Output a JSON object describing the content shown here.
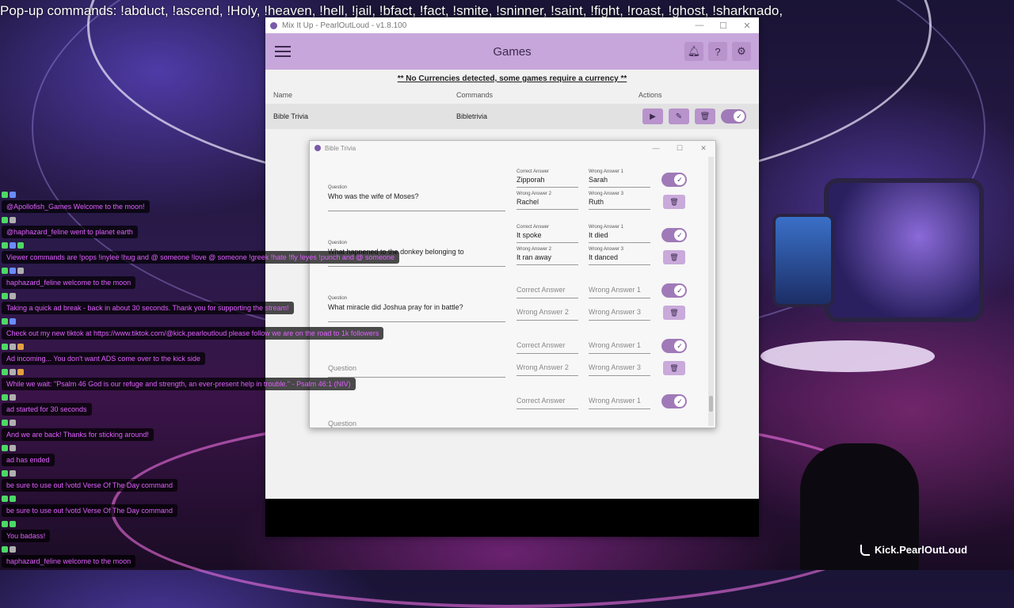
{
  "ticker": "Pop-up commands: !abduct, !ascend, !Holy, !heaven, !hell,  !jail, !bfact, !fact, !smite, !sninner, !saint, !fight, !roast, !ghost, !sharknado,",
  "app": {
    "title": "Mix It Up - PearlOutLoud - v1.8.100",
    "header_title": "Games",
    "notice": "** No Currencies detected, some games require a currency **",
    "columns": {
      "name": "Name",
      "commands": "Commands",
      "actions": "Actions"
    },
    "games": [
      {
        "name": "Bible Trivia",
        "command": "Bibletrivia",
        "enabled": true
      }
    ],
    "icons": [
      "menu-icon",
      "bell-icon",
      "help-icon",
      "gear-icon"
    ],
    "accent": "#c7a6db"
  },
  "dialog": {
    "title": "Bible Trivia",
    "labels": {
      "question": "Question",
      "correct": "Correct Answer",
      "wrong1": "Wrong Answer 1",
      "wrong2": "Wrong Answer 2",
      "wrong3": "Wrong Answer 3"
    },
    "questions": [
      {
        "question": "Who was the wife of Moses?",
        "correct": "Zipporah",
        "wrong1": "Sarah",
        "wrong2": "Rachel",
        "wrong3": "Ruth",
        "enabled": true
      },
      {
        "question": "What happened to the donkey belonging to",
        "correct": "It spoke",
        "wrong1": "It died",
        "wrong2": "It ran away",
        "wrong3": "It danced",
        "enabled": true
      },
      {
        "question": "What miracle did Joshua pray for in battle?",
        "correct": "",
        "wrong1": "",
        "wrong2": "",
        "wrong3": "",
        "enabled": true
      },
      {
        "question": "",
        "correct": "",
        "wrong1": "",
        "wrong2": "",
        "wrong3": "",
        "enabled": true
      },
      {
        "question": "",
        "correct": "",
        "wrong1": "",
        "wrong2": "",
        "wrong3": "",
        "enabled": true
      }
    ]
  },
  "chat": [
    {
      "text": "@Apollofish_Games Welcome to the moon!"
    },
    {
      "text": "@haphazard_feline went to planet earth"
    },
    {
      "text": "Viewer commands are !pops !inylee !hug and @ someone !love @ someone !greek !hate !fly !eyes !punch and @ someone"
    },
    {
      "text": "haphazard_feline welcome to the moon"
    },
    {
      "text": "Taking a quick ad break - back in about 30 seconds. Thank you for supporting the stream!"
    },
    {
      "text": "Check out my new tiktok at https://www.tiktok.com/@kick.pearloutloud please follow we are on the road to 1k followers"
    },
    {
      "text": "Ad incoming... You don't want ADS come over to the kick side"
    },
    {
      "text": "While we wait: \"Psalm 46 God is our refuge and strength, an ever-present help in trouble.\" - Psalm 46:1 (NIV)"
    },
    {
      "text": "ad started for 30 seconds"
    },
    {
      "text": "And we are back! Thanks for sticking around!"
    },
    {
      "text": "ad has ended"
    },
    {
      "text": "be sure to use out !votd Verse Of The Day command"
    },
    {
      "text": "be sure to use out !votd Verse Of The Day command"
    },
    {
      "text": "You badass!"
    },
    {
      "text": "haphazard_feline welcome to the moon"
    }
  ],
  "brand": "Kick.PearlOutLoud"
}
